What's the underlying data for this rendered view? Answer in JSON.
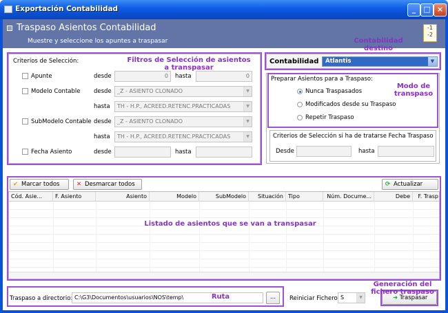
{
  "window": {
    "title": "Exportación Contabilidad",
    "minimize": "_",
    "maximize": "□",
    "close": "×"
  },
  "header": {
    "title": "Traspaso Asientos Contabilidad",
    "subtitle": "Muestre y seleccione los apuntes a traspasar",
    "doc_icon_text": "-1\n-2"
  },
  "annotations": {
    "filtros": "Filtros de Selección de asientos a transpasar",
    "contabilidad_destino": "Contabilidad destino",
    "modo": "Modo de transpaso",
    "listado": "Listado de asientos que se van a transpasar",
    "ruta": "Ruta",
    "generacion": "Generación del fichero traspaso"
  },
  "criterios": {
    "title": "Criterios de Selección:",
    "apunte": {
      "label": "Apunte",
      "desde": "desde",
      "desde_value": "0",
      "hasta": "hasta",
      "hasta_value": "0"
    },
    "modelo": {
      "label": "Modelo Contable",
      "desde": "desde",
      "desde_value": "_Z - ASIENTO CLONADO",
      "hasta": "hasta",
      "hasta_value": "TH - H.P., ACREED.RETENC.PRACTICADAS"
    },
    "submodelo": {
      "label": "SubModelo Contable",
      "desde": "desde",
      "desde_value": "_Z - ASIENTO CLONADO",
      "hasta": "hasta",
      "hasta_value": "TH - H.P., ACREED.RETENC.PRACTICADAS"
    },
    "fecha": {
      "label": "Fecha Asiento",
      "desde": "desde",
      "hasta": "hasta"
    }
  },
  "contabilidad": {
    "label": "Contabilidad",
    "value": "Atlantis"
  },
  "preparar": {
    "title": "Preparar Asientos para a Traspaso:",
    "options": [
      "Nunca Traspasados",
      "Modificados desde su Traspaso",
      "Repetir Traspaso"
    ],
    "selected_index": 0
  },
  "fecha_traspaso": {
    "title": "Criterios de Selección si ha de tratarse Fecha Traspaso",
    "desde": "Desde",
    "hasta": "hasta"
  },
  "toolbar": {
    "marcar": "Marcar todos",
    "desmarcar": "Desmarcar todos",
    "actualizar": "Actualizar"
  },
  "grid": {
    "columns": [
      "Cód. Asie...",
      "F. Asiento",
      "Asiento",
      "Modelo",
      "SubModelo",
      "Situación",
      "Tipo",
      "Núm. Docume...",
      "Debe",
      "F. Trasp"
    ]
  },
  "footer": {
    "directorio_label": "Traspaso a directorio:",
    "directorio_value": "C:\\G3\\Documentos\\usuarios\\NOS\\temp\\",
    "browse": "...",
    "reiniciar_label": "Reiniciar Fichero:",
    "reiniciar_value": "S",
    "traspasar": "Traspasar"
  },
  "colors": {
    "annotation": "#8a30c8",
    "header_bg": "#6275a6",
    "titlebar": "#0f5fe6"
  }
}
